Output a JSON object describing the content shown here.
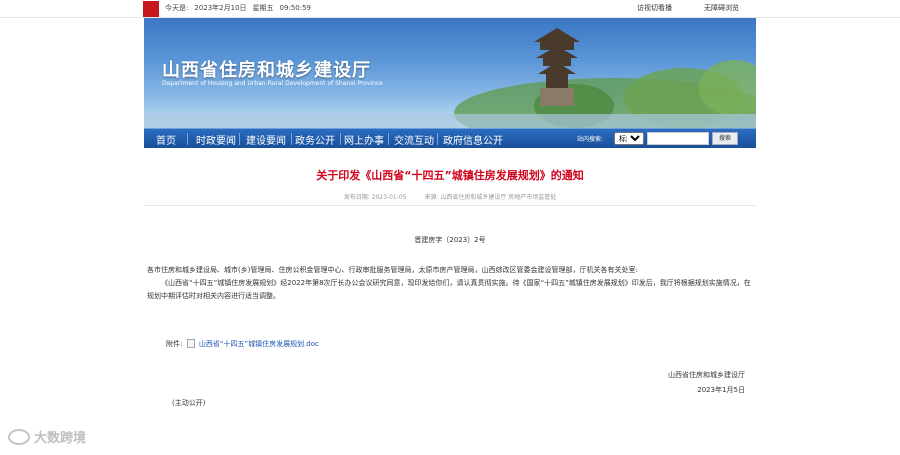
{
  "topbar": {
    "badge_text": "山西\n省政",
    "date_prefix": "今天是:",
    "date": "2023年2月10日",
    "weekday": "星期五",
    "time": "09:50:59",
    "link_friendly": "访视切看播",
    "link_accessible": "无障碍浏览"
  },
  "banner": {
    "title_cn": "山西省住房和城乡建设厅",
    "title_en": "Department of Housing and Urban-Rural Development of Shanxi Province"
  },
  "nav": {
    "items": [
      "首页",
      "时政要闻",
      "建设要闻",
      "政务公开",
      "网上办事",
      "交流互动",
      "政府信息公开"
    ],
    "search_label": "站内搜索:",
    "search_option": "标题",
    "search_button": "搜索"
  },
  "article": {
    "title": "关于印发《山西省“十四五”城镇住房发展规划》的通知",
    "publish_date": "发布日期: 2023-01-05",
    "source": "来源: 山西省住房和城乡建设厅 房地产市场监管处",
    "doc_number": "晋建房字〔2023〕2号",
    "para1": "各市住房和城乡建设局、城市(乡)管理局、住房公积金管理中心、行政审批服务管理局，太原市房产管理局，山西综改区管委会建设管理部，厅机关各有关处室:",
    "para2": "《山西省“十四五”城镇住房发展规划》经2022年第8次厅长办公会议研究同意，现印发给你们，请认真贯彻实施。待《国家“十四五”城镇住房发展规划》印发后，我厅将根据规划实施情况，在规划中期评估时对相关内容进行适当调整。",
    "attachment_label": "附件:",
    "attachment_link": "山西省“十四五”城镇住房发展规划.doc",
    "sign_org": "山西省住房和城乡建设厅",
    "sign_date": "2023年1月5日",
    "disclosure": "(主动公开)"
  },
  "watermark": {
    "text": "大数跨境"
  }
}
